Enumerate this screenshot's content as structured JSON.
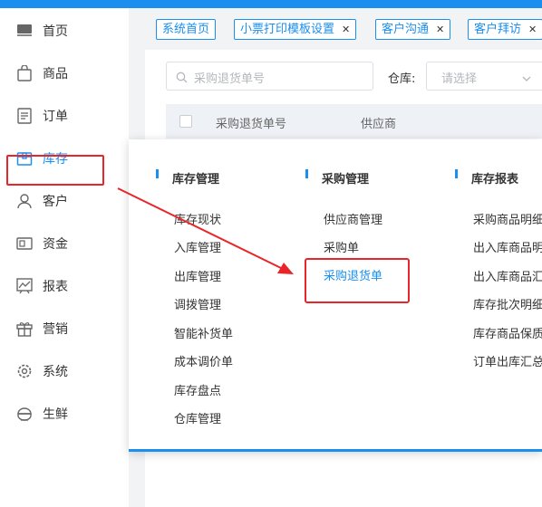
{
  "sidebar": {
    "items": [
      {
        "label": "首页",
        "icon": "monitor-icon"
      },
      {
        "label": "商品",
        "icon": "shopping-bag-icon"
      },
      {
        "label": "订单",
        "icon": "document-icon"
      },
      {
        "label": "库存",
        "icon": "box-icon",
        "active": true
      },
      {
        "label": "客户",
        "icon": "user-icon"
      },
      {
        "label": "资金",
        "icon": "wallet-icon"
      },
      {
        "label": "报表",
        "icon": "chart-icon"
      },
      {
        "label": "营销",
        "icon": "gift-icon"
      },
      {
        "label": "系统",
        "icon": "gear-icon"
      },
      {
        "label": "生鲜",
        "icon": "food-bowl-icon"
      }
    ]
  },
  "tabs": [
    {
      "label": "系统首页",
      "closable": false
    },
    {
      "label": "小票打印模板设置",
      "closable": true
    },
    {
      "label": "客户沟通",
      "closable": true
    },
    {
      "label": "客户拜访",
      "closable": true
    }
  ],
  "filters": {
    "search_placeholder": "采购退货单号",
    "warehouse_label": "仓库:",
    "warehouse_placeholder": "请选择"
  },
  "table": {
    "columns": [
      "采购退货单号",
      "供应商"
    ]
  },
  "mega_menu": {
    "columns": [
      {
        "title": "库存管理",
        "items": [
          "库存现状",
          "入库管理",
          "出库管理",
          "调拨管理",
          "智能补货单",
          "成本调价单",
          "库存盘点",
          "仓库管理"
        ]
      },
      {
        "title": "采购管理",
        "items": [
          "供应商管理",
          "采购单",
          "采购退货单"
        ]
      },
      {
        "title": "库存报表",
        "items": [
          "采购商品明细",
          "出入库商品明",
          "出入库商品汇",
          "库存批次明细",
          "库存商品保质",
          "订单出库汇总"
        ]
      }
    ],
    "selected_item": "采购退货单"
  },
  "colors": {
    "accent": "#1a8ff0",
    "annotation": "#e8262a"
  }
}
